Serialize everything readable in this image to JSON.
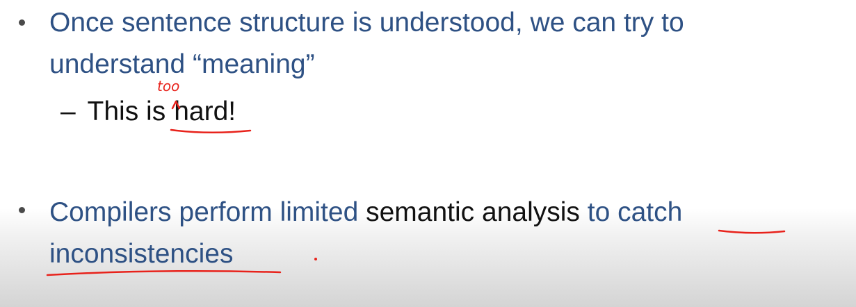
{
  "bullets": [
    {
      "line1": "Once sentence structure is understood, we can try to",
      "line2": "understand “meaning”",
      "sub": {
        "dash": "–",
        "text_before": "This is",
        "text_after": "hard!"
      }
    },
    {
      "line1_blue_a": "Compilers perform limited ",
      "line1_black": "semantic analysis",
      "line1_blue_b": " to catch",
      "line2": "inconsistencies"
    }
  ],
  "annotation": {
    "inserted_word": "too"
  },
  "colors": {
    "bullet_text": "#2e5184",
    "sub_text": "#111111",
    "bullet_dot": "#4a4a4a",
    "ink": "#e8221b"
  }
}
